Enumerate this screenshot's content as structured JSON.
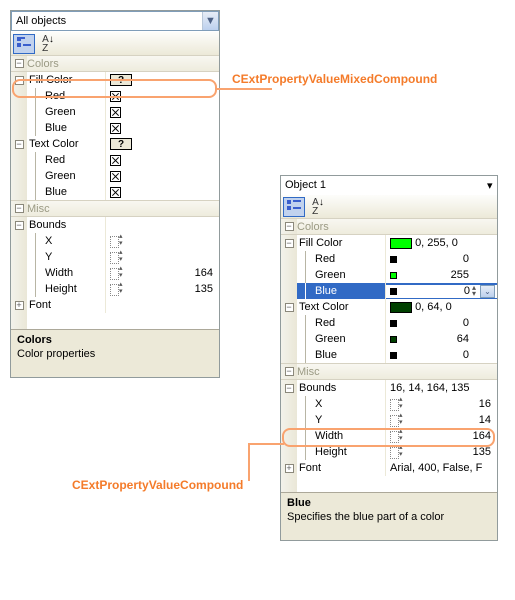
{
  "annotations": {
    "mixed_compound": "CExtPropertyValueMixedCompound",
    "compound": "CExtPropertyValueCompound"
  },
  "panel1": {
    "combo": "All objects",
    "categories": {
      "colors": "Colors",
      "misc": "Misc"
    },
    "props": {
      "fill_color": "Fill Color",
      "text_color": "Text Color",
      "red": "Red",
      "green": "Green",
      "blue": "Blue",
      "bounds": "Bounds",
      "x": "X",
      "y": "Y",
      "width": "Width",
      "height": "Height",
      "font": "Font"
    },
    "vals": {
      "width": "164",
      "height": "135"
    },
    "desc": {
      "title": "Colors",
      "text": "Color properties"
    }
  },
  "panel2": {
    "combo": "Object 1",
    "categories": {
      "colors": "Colors",
      "misc": "Misc"
    },
    "props": {
      "fill_color": "Fill Color",
      "text_color": "Text Color",
      "red": "Red",
      "green": "Green",
      "blue": "Blue",
      "bounds": "Bounds",
      "x": "X",
      "y": "Y",
      "width": "Width",
      "height": "Height",
      "font": "Font"
    },
    "vals": {
      "fill_color": "0, 255, 0",
      "fill_red": "0",
      "fill_green": "255",
      "fill_blue": "0",
      "text_color": "0, 64, 0",
      "text_red": "0",
      "text_green": "64",
      "text_blue": "0",
      "bounds": "16, 14, 164, 135",
      "x": "16",
      "y": "14",
      "width": "164",
      "height": "135",
      "font": "Arial, 400, False, F"
    },
    "colors": {
      "fill_swatch": "#00ff00",
      "text_swatch": "#004000",
      "black": "#000000"
    },
    "desc": {
      "title": "Blue",
      "text": "Specifies the blue part of a color"
    }
  }
}
